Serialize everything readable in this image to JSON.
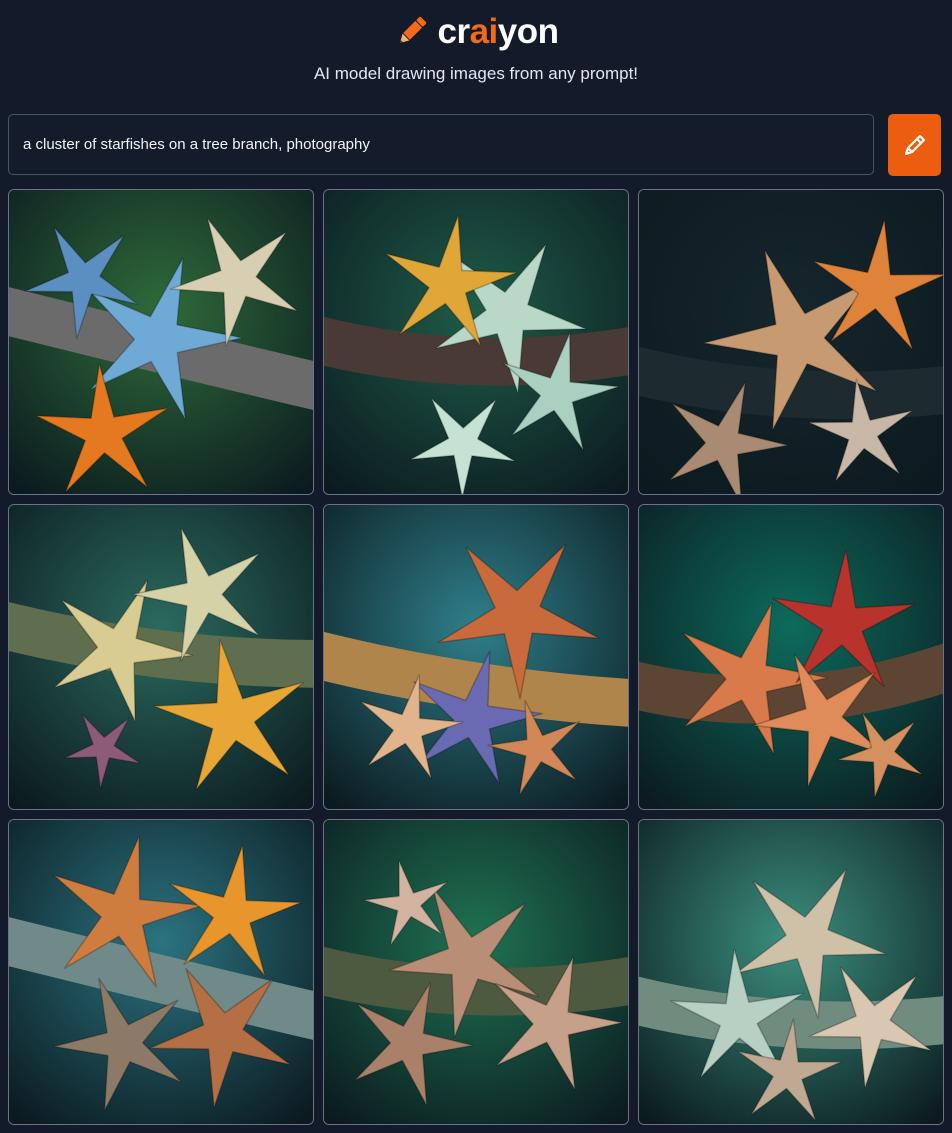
{
  "app": {
    "logo_prefix": "cr",
    "logo_accent": "ai",
    "logo_suffix": "yon",
    "brand_color": "#f26a1b",
    "logo_icon": "pencil-icon"
  },
  "header": {
    "tagline": "AI model drawing images from any prompt!"
  },
  "prompt": {
    "value": "a cluster of starfishes on a tree branch, photography",
    "draw_button_icon": "pencil-icon",
    "button_color": "#ec5d10"
  },
  "gallery": {
    "images": [
      {
        "bg": "#2f6b3a",
        "branch": "#6a6b6a",
        "stars": [
          "#6fa9d6",
          "#e4791f",
          "#d8cfb2",
          "#5c8fc1"
        ]
      },
      {
        "bg": "#1f5c48",
        "branch": "#4a3a35",
        "stars": [
          "#b9d8c8",
          "#e0a638",
          "#a9d0c0",
          "#c5e2d4"
        ]
      },
      {
        "bg": "#15262c",
        "branch": "#1d2a30",
        "stars": [
          "#c79a72",
          "#e0833a",
          "#a98a72",
          "#c8b7a6"
        ]
      },
      {
        "bg": "#2b6a5e",
        "branch": "#5e6e4e",
        "stars": [
          "#d8cc92",
          "#e8a637",
          "#d4d2a6",
          "#8d5a78"
        ]
      },
      {
        "bg": "#2f7f8a",
        "branch": "#b0854b",
        "stars": [
          "#c96a3d",
          "#6a6ab2",
          "#e2b48c",
          "#d28759"
        ]
      },
      {
        "bg": "#0d6b5c",
        "branch": "#5c4633",
        "stars": [
          "#d87a4a",
          "#b8332c",
          "#e08c5a",
          "#d59060"
        ]
      },
      {
        "bg": "#2b7380",
        "branch": "#6f8a88",
        "stars": [
          "#cf7c3f",
          "#e8952c",
          "#8c7a66",
          "#b56f45"
        ]
      },
      {
        "bg": "#1f7352",
        "branch": "#4e5a40",
        "stars": [
          "#b98e76",
          "#a98068",
          "#c7a08a",
          "#d2b3a0"
        ]
      },
      {
        "bg": "#3c8f7d",
        "branch": "#6f8c7f",
        "stars": [
          "#cfc0a8",
          "#b8d0c4",
          "#d9c7b2",
          "#bfa992"
        ]
      }
    ]
  }
}
